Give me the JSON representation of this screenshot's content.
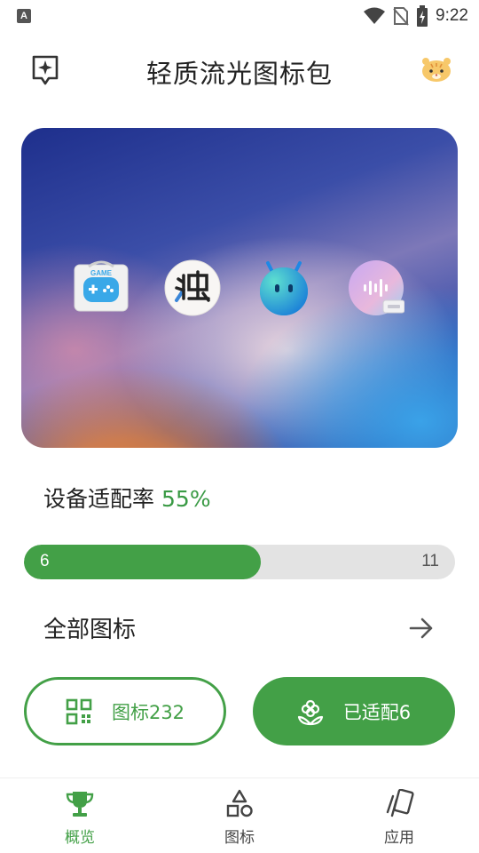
{
  "status_bar": {
    "time": "9:22"
  },
  "header": {
    "title": "轻质流光图标包"
  },
  "banner": {
    "icons": [
      "game-center-app-icon",
      "zhuo-app-icon",
      "blue-robot-app-icon",
      "voice-assistant-app-icon"
    ]
  },
  "adaptation": {
    "label": "设备适配率",
    "rate_text": "55%",
    "progress_fraction": 0.55,
    "adapted_count": "6",
    "total_count": "11"
  },
  "all_icons": {
    "label": "全部图标"
  },
  "buttons": {
    "icons_label": "图标232",
    "adapted_label": "已适配6"
  },
  "bottom_nav": {
    "items": [
      {
        "label": "概览",
        "active": true
      },
      {
        "label": "图标",
        "active": false
      },
      {
        "label": "应用",
        "active": false
      }
    ]
  },
  "colors": {
    "accent": "#43a047",
    "progress_track": "#e3e3e3"
  }
}
